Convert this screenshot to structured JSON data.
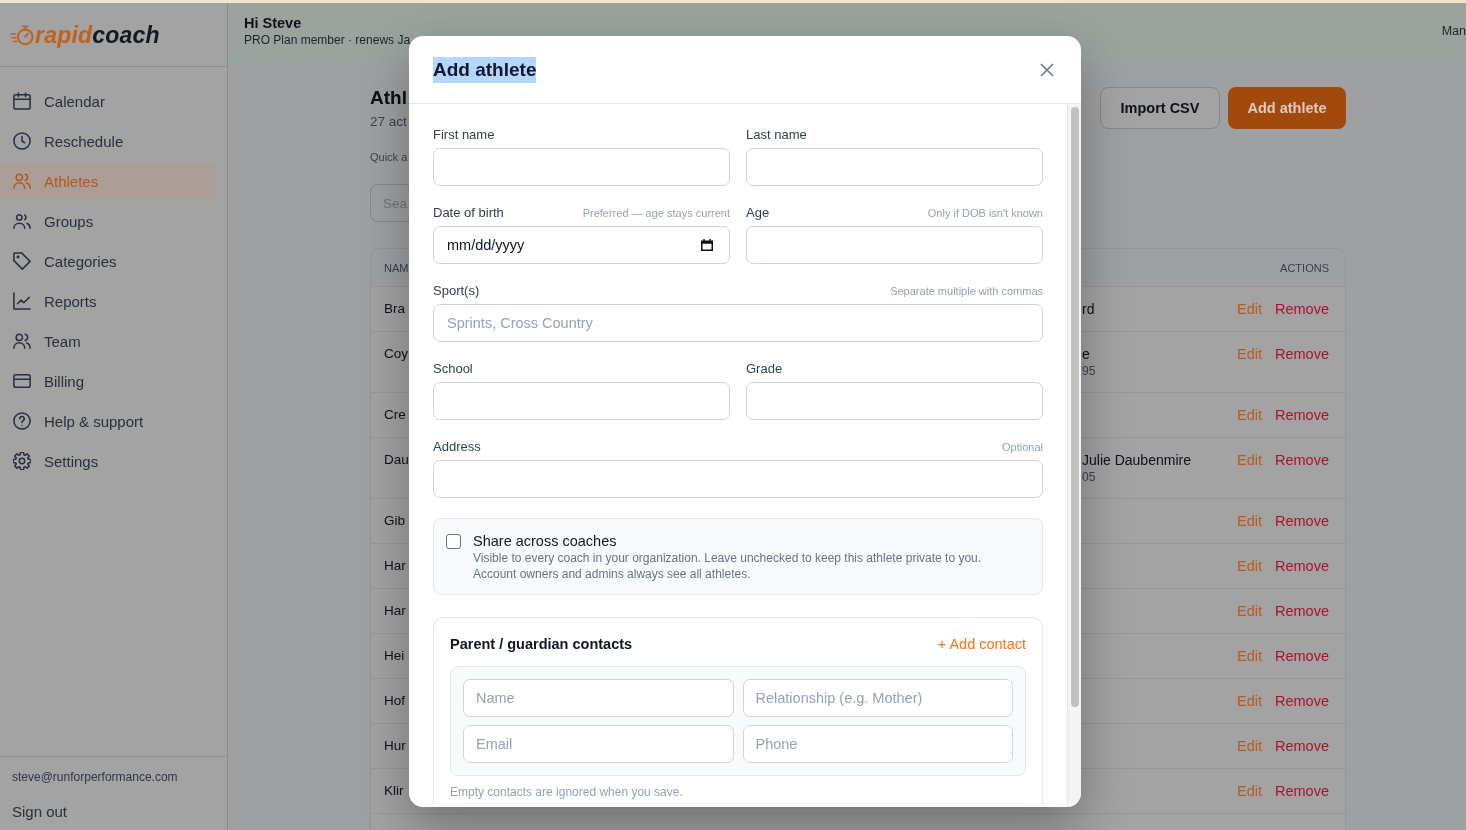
{
  "sidebar": {
    "logo": {
      "text_1": "rapid",
      "text_2": "coach"
    },
    "items": [
      {
        "label": "Calendar",
        "selected": false
      },
      {
        "label": "Reschedule",
        "selected": false
      },
      {
        "label": "Athletes",
        "selected": true
      },
      {
        "label": "Groups",
        "selected": false
      },
      {
        "label": "Categories",
        "selected": false
      },
      {
        "label": "Reports",
        "selected": false
      },
      {
        "label": "Team",
        "selected": false
      },
      {
        "label": "Billing",
        "selected": false
      },
      {
        "label": "Help & support",
        "selected": false
      },
      {
        "label": "Settings",
        "selected": false
      }
    ],
    "account_email": "steve@runforperformance.com",
    "sign_out": "Sign out"
  },
  "header": {
    "greeting": "Hi Steve",
    "plan": "PRO Plan member · renews Ja",
    "right_text": "Man"
  },
  "page": {
    "title": "Athl",
    "subtitle": "27 act",
    "quick_label": "Quick a",
    "search": {
      "placeholder": "Sea"
    },
    "buttons": [
      {
        "label": "Import CSV",
        "kind": "secondary"
      },
      {
        "label": "Add athlete",
        "kind": "primary"
      }
    ],
    "table": {
      "columns": [
        "NAM",
        "ACTIONS"
      ],
      "rows": [
        {
          "name": "Bra",
          "column_2": "rd",
          "actions": [
            {
              "label": "Edit",
              "kind": "edit"
            },
            {
              "label": "Remove",
              "kind": "remove"
            }
          ]
        },
        {
          "name": "Coy",
          "column_2": "e",
          "column_2_sub": "95",
          "actions": [
            {
              "label": "Edit",
              "kind": "edit"
            },
            {
              "label": "Remove",
              "kind": "remove"
            }
          ]
        },
        {
          "name": "Cre",
          "actions": [
            {
              "label": "Edit",
              "kind": "edit"
            },
            {
              "label": "Remove",
              "kind": "remove"
            }
          ]
        },
        {
          "name": "Dau",
          "column_2": "Julie Daubenmire",
          "column_2_sub": "05",
          "actions": [
            {
              "label": "Edit",
              "kind": "edit"
            },
            {
              "label": "Remove",
              "kind": "remove"
            }
          ]
        },
        {
          "name": "Gib",
          "actions": [
            {
              "label": "Edit",
              "kind": "edit"
            },
            {
              "label": "Remove",
              "kind": "remove"
            }
          ]
        },
        {
          "name": "Har",
          "actions": [
            {
              "label": "Edit",
              "kind": "edit"
            },
            {
              "label": "Remove",
              "kind": "remove"
            }
          ]
        },
        {
          "name": "Har",
          "actions": [
            {
              "label": "Edit",
              "kind": "edit"
            },
            {
              "label": "Remove",
              "kind": "remove"
            }
          ]
        },
        {
          "name": "Hei",
          "actions": [
            {
              "label": "Edit",
              "kind": "edit"
            },
            {
              "label": "Remove",
              "kind": "remove"
            }
          ]
        },
        {
          "name": "Hof",
          "actions": [
            {
              "label": "Edit",
              "kind": "edit"
            },
            {
              "label": "Remove",
              "kind": "remove"
            }
          ]
        },
        {
          "name": "Hur",
          "actions": [
            {
              "label": "Edit",
              "kind": "edit"
            },
            {
              "label": "Remove",
              "kind": "remove"
            }
          ]
        },
        {
          "name": "Klir",
          "actions": [
            {
              "label": "Edit",
              "kind": "edit"
            },
            {
              "label": "Remove",
              "kind": "remove"
            }
          ]
        }
      ]
    }
  },
  "modal": {
    "title": "Add athlete",
    "title_highlighted": true,
    "fields": [
      {
        "label": "First name",
        "kind": "text"
      },
      {
        "label": "Last name",
        "kind": "text"
      },
      {
        "label": "Date of birth",
        "hint": "Preferred — age stays current",
        "kind": "date",
        "placeholder": "mm/dd/yyyy"
      },
      {
        "label": "Age",
        "hint": "Only if DOB isn't known",
        "kind": "text"
      },
      {
        "label": "Sport(s)",
        "hint": "Separate multiple with commas",
        "kind": "text",
        "placeholder": "Sprints, Cross Country",
        "wide": true
      },
      {
        "label": "School",
        "kind": "text"
      },
      {
        "label": "Grade",
        "kind": "text"
      },
      {
        "label": "Address",
        "hint": "Optional",
        "kind": "text",
        "wide": true
      }
    ],
    "share": {
      "label": "Share across coaches",
      "description": "Visible to every coach in your organization. Leave unchecked to keep this athlete private to you. Account owners and admins always see all athletes.",
      "checked": false
    },
    "contacts": {
      "title": "Parent / guardian contacts",
      "add_link": "+ Add contact",
      "inputs": [
        {
          "placeholder": "Name"
        },
        {
          "placeholder": "Relationship (e.g. Mother)"
        },
        {
          "placeholder": "Email"
        },
        {
          "placeholder": "Phone"
        }
      ],
      "note": "Empty contacts are ignored when you save."
    }
  }
}
